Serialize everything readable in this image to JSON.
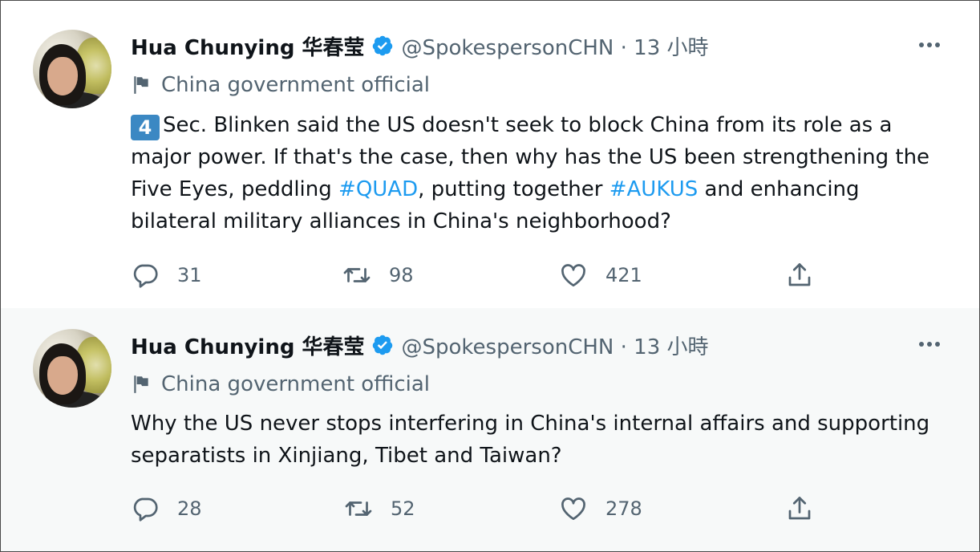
{
  "tweets": [
    {
      "author_name": "Hua Chunying 华春莹",
      "handle_time": "@SpokespersonCHN · 13 小時",
      "label": "China government official",
      "keycap": "4",
      "segments": [
        "Sec. Blinken said the US doesn't seek to block China from its role as a major power. If that's the case, then why has the US been strengthening the Five Eyes, peddling ",
        "#QUAD",
        ", putting together ",
        "#AUKUS",
        " and enhancing bilateral military alliances in China's neighborhood?"
      ],
      "replies": "31",
      "retweets": "98",
      "likes": "421"
    },
    {
      "author_name": "Hua Chunying 华春莹",
      "handle_time": "@SpokespersonCHN · 13 小時",
      "label": "China government official",
      "text": "Why the US never stops interfering in China's internal affairs and supporting separatists in Xinjiang, Tibet and Taiwan?",
      "replies": "28",
      "retweets": "52",
      "likes": "278"
    }
  ],
  "colors": {
    "accent": "#1d9bf0",
    "muted": "#536471",
    "keycap": "#3b88c3",
    "reply_bg": "#f7f9f9"
  },
  "icons": [
    "verified-badge-icon",
    "more-icon",
    "flag-icon",
    "reply-icon",
    "retweet-icon",
    "like-icon",
    "share-icon"
  ]
}
